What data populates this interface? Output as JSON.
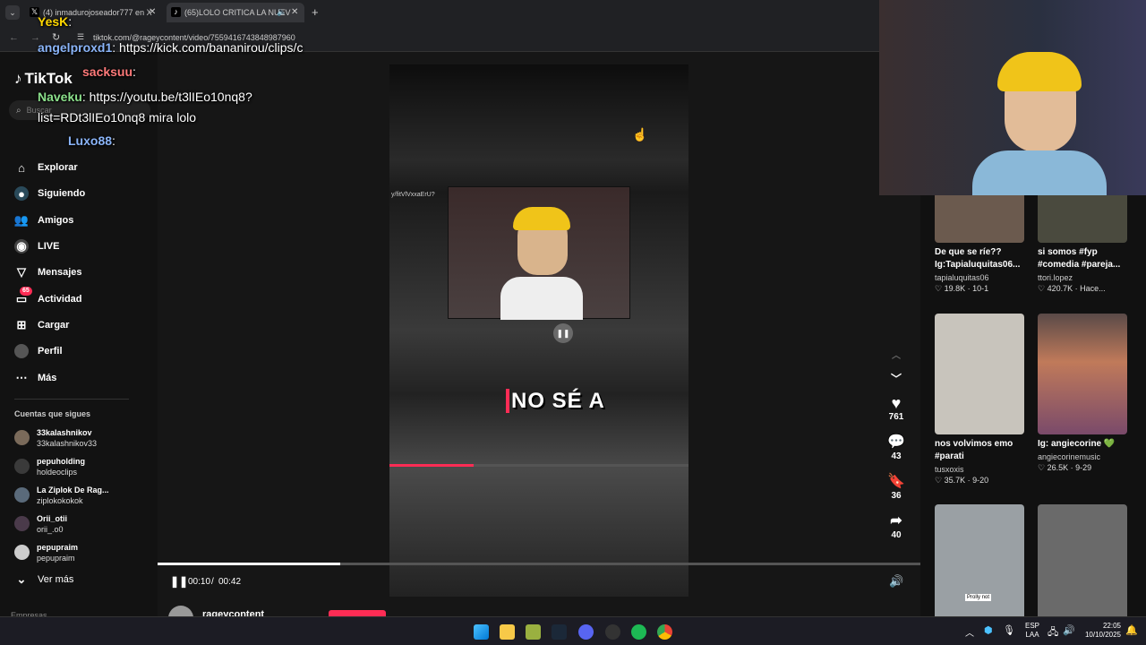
{
  "browser": {
    "tabs": [
      {
        "label": "(4) inmadurojoseador777 en X",
        "icon": "x-logo"
      },
      {
        "label": "(65)LOLO CRITICA LA NUEV",
        "icon": "tiktok-logo"
      }
    ],
    "url": "tiktok.com/@rageycontent/video/7559416743848987960"
  },
  "tiktok": {
    "logo": "TikTok",
    "search_placeholder": "Buscar",
    "nav": [
      {
        "label": "Explorar",
        "icon": "compass-icon"
      },
      {
        "label": "Siguiendo",
        "icon": "following-icon"
      },
      {
        "label": "Amigos",
        "icon": "friends-icon"
      },
      {
        "label": "LIVE",
        "icon": "live-icon"
      },
      {
        "label": "Mensajes",
        "icon": "send-icon"
      },
      {
        "label": "Actividad",
        "icon": "activity-icon",
        "badge": "65"
      },
      {
        "label": "Cargar",
        "icon": "upload-icon"
      },
      {
        "label": "Perfil",
        "icon": "profile-icon"
      },
      {
        "label": "Más",
        "icon": "more-icon"
      }
    ],
    "following_title": "Cuentas que sigues",
    "following": [
      {
        "name": "33kalashnikov",
        "handle": "33kalashnikov33"
      },
      {
        "name": "pepuholding",
        "handle": "holdeoclips"
      },
      {
        "name": "La Ziplok De Rag...",
        "handle": "ziplokokokok"
      },
      {
        "name": "Orii_otii",
        "handle": "orii_.o0"
      },
      {
        "name": "pepupraim",
        "handle": "pepupraim"
      }
    ],
    "see_more": "Ver más",
    "footer_cut": "Empresas"
  },
  "video": {
    "caption": "NO SÉ A",
    "inner_url": "y/fitVlVxxaErU?",
    "time_current": "00:10",
    "time_total": "00:42",
    "progress": 0.24,
    "author": "rageycontent"
  },
  "actions": {
    "likes": "761",
    "comments": "43",
    "saves": "36",
    "shares": "40"
  },
  "recommendations": [
    {
      "caption": "De que se ríe?? Ig:Tapialuquitas06...",
      "author": "tapialuquitas06",
      "likes": "19.8K",
      "date": "10-1",
      "thumb": "#6b5a4e"
    },
    {
      "caption": "si somos #fyp #comedia #pareja...",
      "author": "ttori.lopez",
      "likes": "420.7K",
      "date": "Hace...",
      "thumb": "#4a4a3e"
    },
    {
      "caption": "nos volvimos emo #parati",
      "author": "tusxoxis",
      "likes": "35.7K",
      "date": "9-20",
      "thumb": "#c8c4bc"
    },
    {
      "caption": "Ig: angiecorine 💚",
      "author": "angiecorinemusic",
      "likes": "26.5K",
      "date": "9-29",
      "thumb": "#8a5a4a"
    },
    {
      "caption": "",
      "author": "",
      "likes": "",
      "date": "",
      "thumb": "#9aa0a4",
      "sticker": "Prolly not"
    },
    {
      "caption": "",
      "author": "",
      "likes": "",
      "date": "",
      "thumb": "#6a6a6a"
    }
  ],
  "chat": [
    {
      "user": "YesK",
      "text": ""
    },
    {
      "user": "angelproxd1",
      "text": "https://kick.com/bananirou/clips/c"
    },
    {
      "user": "sacksuu",
      "text": ""
    },
    {
      "user": "Naveku",
      "text": "https://youtu.be/t3lIEo10nq8?"
    },
    {
      "user": "",
      "text": "list=RDt3lIEo10nq8 mira lolo"
    },
    {
      "user": "Luxo88",
      "text": ""
    }
  ],
  "taskbar": {
    "lang": "ESP",
    "lang2": "LAA",
    "time": "22:05",
    "date": "10/10/2025"
  },
  "colors": {
    "accent": "#fe2c55",
    "save": "#facc15",
    "chat_user": "#8ab4f8"
  }
}
